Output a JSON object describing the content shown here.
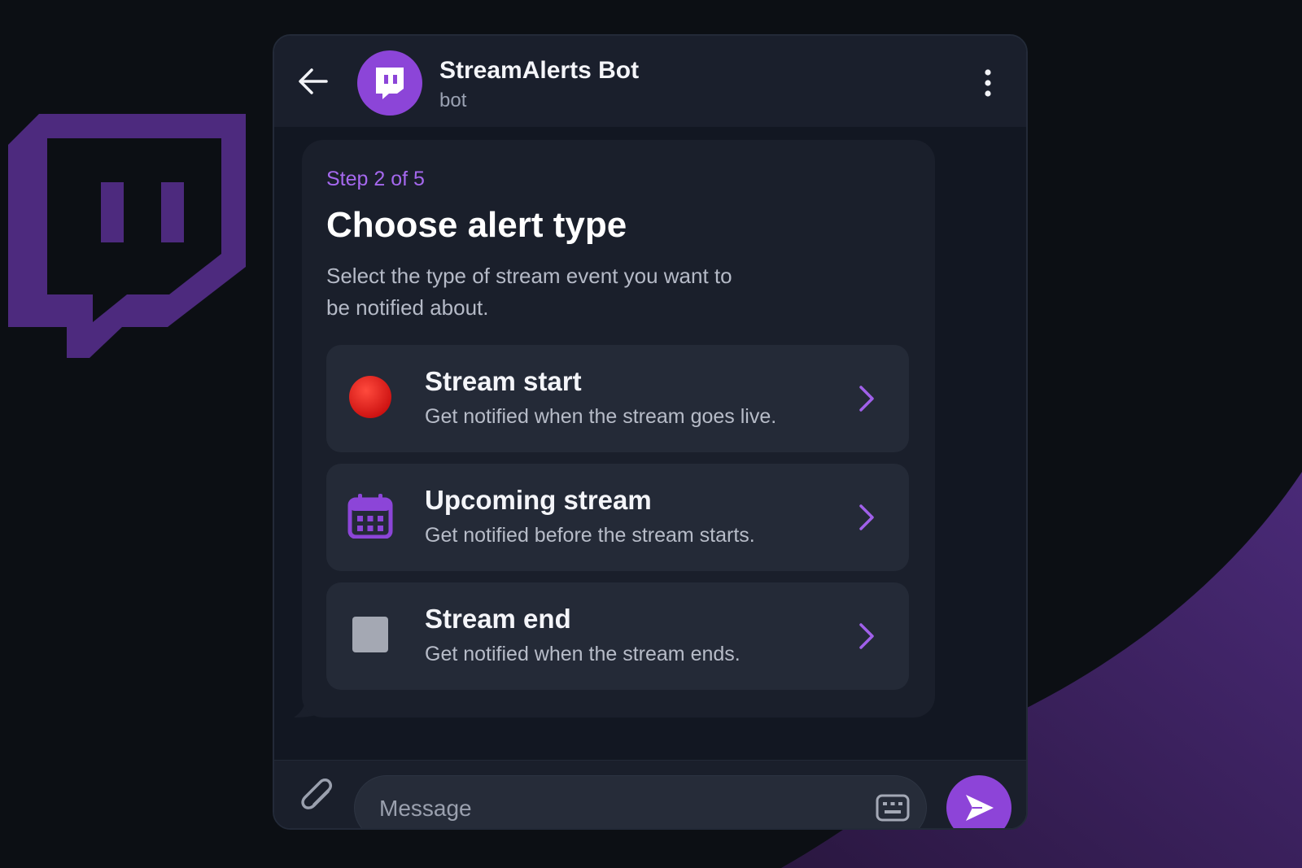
{
  "colors": {
    "accent": "#8c45d8",
    "step_text": "#a568ee",
    "background": "#0c0f14",
    "panel": "#121722",
    "card": "#242a37"
  },
  "header": {
    "back_icon": "arrow-left-icon",
    "avatar_icon": "twitch-glitch-icon",
    "bot_name": "StreamAlerts Bot",
    "bot_status": "bot",
    "menu_icon": "more-vertical-icon"
  },
  "message": {
    "step": "Step 2 of 5",
    "title": "Choose alert type",
    "subtitle": "Select the type of stream event you want to be notified about.",
    "options": [
      {
        "icon": "red-circle-icon",
        "title": "Stream start",
        "description": "Get notified when the stream goes live."
      },
      {
        "icon": "calendar-icon",
        "title": "Upcoming stream",
        "description": "Get notified before the stream starts."
      },
      {
        "icon": "stop-square-icon",
        "title": "Stream end",
        "description": "Get notified when the stream ends."
      }
    ]
  },
  "composer": {
    "attach_icon": "paperclip-icon",
    "placeholder": "Message",
    "keyboard_icon": "keyboard-icon",
    "send_icon": "send-icon"
  }
}
